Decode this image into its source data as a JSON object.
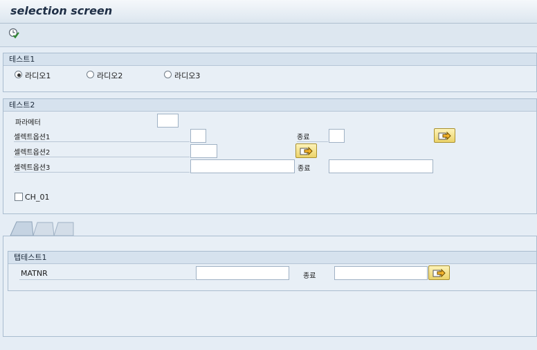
{
  "window": {
    "title": "selection screen"
  },
  "toolbar": {
    "execute_icon": "execute-clock-check-icon"
  },
  "block1": {
    "title": "테스트1",
    "radios": [
      {
        "label": "라디오1",
        "selected": true
      },
      {
        "label": "라디오2",
        "selected": false
      },
      {
        "label": "라디오3",
        "selected": false
      }
    ]
  },
  "block2": {
    "title": "테스트2",
    "parameter_label": "파라메터",
    "parameter_value": "",
    "select_options": [
      {
        "label": "셀렉트옵션1",
        "low": "",
        "to_label": "종료",
        "high": "",
        "button_icon": "multiple-selection-arrow-icon"
      },
      {
        "label": "셀렉트옵션2",
        "low": "",
        "button_icon": "multiple-selection-arrow-icon"
      },
      {
        "label": "셀렉트옵션3",
        "low": "",
        "to_label": "종료",
        "high": ""
      }
    ],
    "checkbox": {
      "label": "CH_01",
      "checked": false
    }
  },
  "tabstrip": {
    "tabs": [
      {
        "label": "",
        "active": true
      },
      {
        "label": "",
        "active": false
      },
      {
        "label": "",
        "active": false
      }
    ]
  },
  "tab_block": {
    "title": "탭테스트1",
    "field_label": "MATNR",
    "low": "",
    "to_label": "종료",
    "high": "",
    "button_icon": "multiple-selection-arrow-icon"
  },
  "colors": {
    "background": "#e5edf5",
    "button": "#f5e28e",
    "title_text": "#1f2f46"
  }
}
